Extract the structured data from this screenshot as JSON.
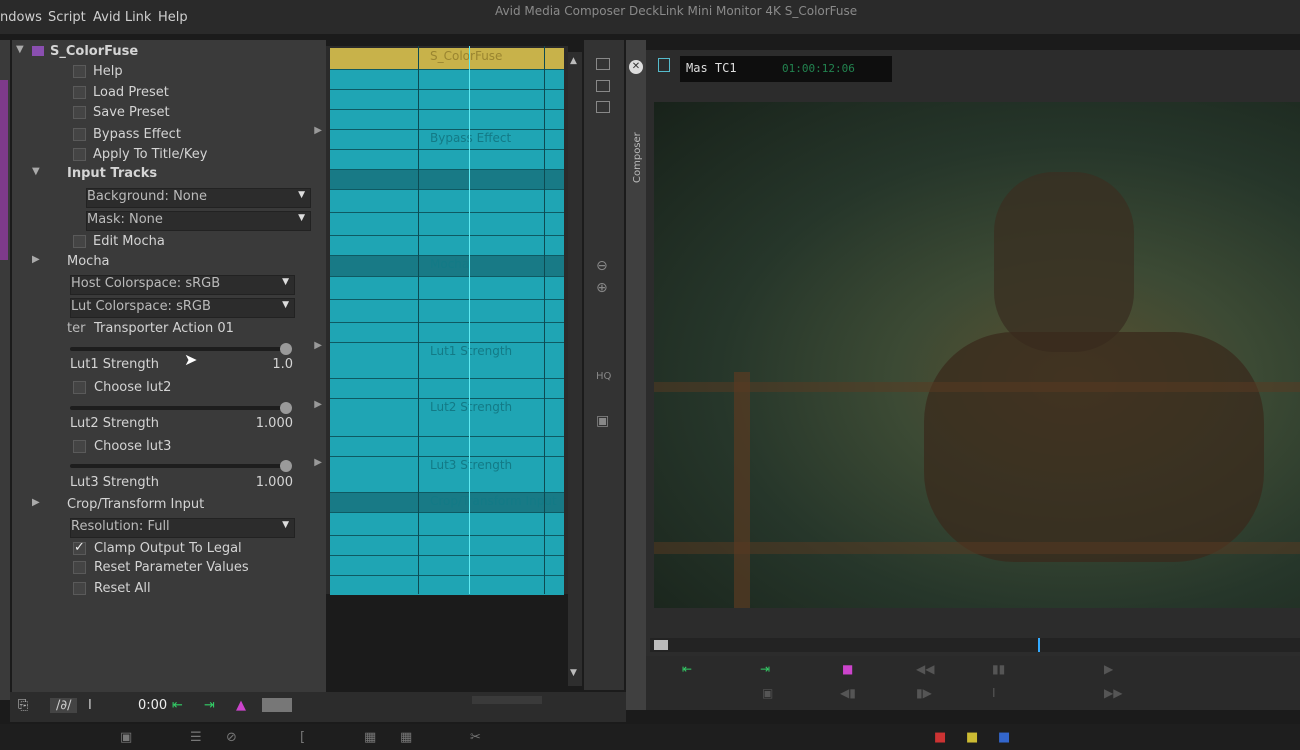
{
  "menu": {
    "items": [
      "ndows",
      "Script",
      "Avid Link",
      "Help"
    ],
    "window_title": "Avid Media Composer DeckLink Mini Monitor 4K  S_ColorFuse"
  },
  "effect_editor": {
    "effect_name": "S_ColorFuse",
    "rows": {
      "help": "Help",
      "load_preset": "Load Preset",
      "save_preset": "Save Preset",
      "bypass_effect": "Bypass Effect",
      "apply_title_key": "Apply To Title/Key",
      "input_tracks": "Input Tracks",
      "background": "Background: None",
      "mask": "Mask: None",
      "edit_mocha": "Edit Mocha",
      "mocha": "Mocha",
      "host_colorspace": "Host Colorspace: sRGB",
      "lut_colorspace": "Lut Colorspace: sRGB",
      "transporter_prefix": "ter",
      "transporter_action": "Transporter Action 01",
      "lut1_strength_label": "Lut1 Strength",
      "lut1_strength_value": "1.0",
      "choose_lut2": "Choose lut2",
      "lut2_strength_label": "Lut2 Strength",
      "lut2_strength_value": "1.000",
      "choose_lut3": "Choose lut3",
      "lut3_strength_label": "Lut3 Strength",
      "lut3_strength_value": "1.000",
      "crop_transform": "Crop/Transform Input",
      "resolution": "Resolution: Full",
      "clamp_output": "Clamp Output To Legal",
      "reset_params": "Reset Parameter Values",
      "reset_all": "Reset All"
    },
    "levels": {
      "lut1_strength": 1.0,
      "lut2_strength": 1.0,
      "lut3_strength": 1.0
    },
    "checked": {
      "clamp_output": true
    }
  },
  "keyframes": {
    "labels": {
      "effect": "S_ColorFuse",
      "bypass": "Bypass Effect",
      "mocha": "Mocha",
      "lut1": "Lut1 Strength",
      "lut2": "Lut2 Strength",
      "lut3": "Lut3 Strength",
      "crop": "Crop/Transform Input"
    },
    "colors": {
      "track": "#1fa5b4",
      "header": "#c8b24a",
      "playhead": "#5fe8f0"
    }
  },
  "side_tools": {
    "hq_label": "HQ"
  },
  "bottom_toolbar": {
    "timecode": "0:00"
  },
  "monitor": {
    "tab_label": "Composer",
    "tc_label": "Mas  TC1",
    "tc_value": "01:00:12:06"
  }
}
